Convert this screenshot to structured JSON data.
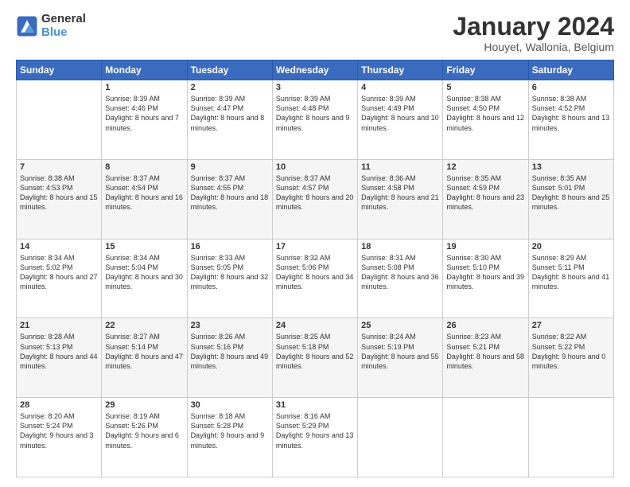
{
  "logo": {
    "line1": "General",
    "line2": "Blue"
  },
  "title": "January 2024",
  "location": "Houyet, Wallonia, Belgium",
  "weekdays": [
    "Sunday",
    "Monday",
    "Tuesday",
    "Wednesday",
    "Thursday",
    "Friday",
    "Saturday"
  ],
  "weeks": [
    [
      {
        "day": "",
        "sunrise": "",
        "sunset": "",
        "daylight": ""
      },
      {
        "day": "1",
        "sunrise": "Sunrise: 8:39 AM",
        "sunset": "Sunset: 4:46 PM",
        "daylight": "Daylight: 8 hours and 7 minutes."
      },
      {
        "day": "2",
        "sunrise": "Sunrise: 8:39 AM",
        "sunset": "Sunset: 4:47 PM",
        "daylight": "Daylight: 8 hours and 8 minutes."
      },
      {
        "day": "3",
        "sunrise": "Sunrise: 8:39 AM",
        "sunset": "Sunset: 4:48 PM",
        "daylight": "Daylight: 8 hours and 9 minutes."
      },
      {
        "day": "4",
        "sunrise": "Sunrise: 8:39 AM",
        "sunset": "Sunset: 4:49 PM",
        "daylight": "Daylight: 8 hours and 10 minutes."
      },
      {
        "day": "5",
        "sunrise": "Sunrise: 8:38 AM",
        "sunset": "Sunset: 4:50 PM",
        "daylight": "Daylight: 8 hours and 12 minutes."
      },
      {
        "day": "6",
        "sunrise": "Sunrise: 8:38 AM",
        "sunset": "Sunset: 4:52 PM",
        "daylight": "Daylight: 8 hours and 13 minutes."
      }
    ],
    [
      {
        "day": "7",
        "sunrise": "Sunrise: 8:38 AM",
        "sunset": "Sunset: 4:53 PM",
        "daylight": "Daylight: 8 hours and 15 minutes."
      },
      {
        "day": "8",
        "sunrise": "Sunrise: 8:37 AM",
        "sunset": "Sunset: 4:54 PM",
        "daylight": "Daylight: 8 hours and 16 minutes."
      },
      {
        "day": "9",
        "sunrise": "Sunrise: 8:37 AM",
        "sunset": "Sunset: 4:55 PM",
        "daylight": "Daylight: 8 hours and 18 minutes."
      },
      {
        "day": "10",
        "sunrise": "Sunrise: 8:37 AM",
        "sunset": "Sunset: 4:57 PM",
        "daylight": "Daylight: 8 hours and 20 minutes."
      },
      {
        "day": "11",
        "sunrise": "Sunrise: 8:36 AM",
        "sunset": "Sunset: 4:58 PM",
        "daylight": "Daylight: 8 hours and 21 minutes."
      },
      {
        "day": "12",
        "sunrise": "Sunrise: 8:35 AM",
        "sunset": "Sunset: 4:59 PM",
        "daylight": "Daylight: 8 hours and 23 minutes."
      },
      {
        "day": "13",
        "sunrise": "Sunrise: 8:35 AM",
        "sunset": "Sunset: 5:01 PM",
        "daylight": "Daylight: 8 hours and 25 minutes."
      }
    ],
    [
      {
        "day": "14",
        "sunrise": "Sunrise: 8:34 AM",
        "sunset": "Sunset: 5:02 PM",
        "daylight": "Daylight: 8 hours and 27 minutes."
      },
      {
        "day": "15",
        "sunrise": "Sunrise: 8:34 AM",
        "sunset": "Sunset: 5:04 PM",
        "daylight": "Daylight: 8 hours and 30 minutes."
      },
      {
        "day": "16",
        "sunrise": "Sunrise: 8:33 AM",
        "sunset": "Sunset: 5:05 PM",
        "daylight": "Daylight: 8 hours and 32 minutes."
      },
      {
        "day": "17",
        "sunrise": "Sunrise: 8:32 AM",
        "sunset": "Sunset: 5:06 PM",
        "daylight": "Daylight: 8 hours and 34 minutes."
      },
      {
        "day": "18",
        "sunrise": "Sunrise: 8:31 AM",
        "sunset": "Sunset: 5:08 PM",
        "daylight": "Daylight: 8 hours and 36 minutes."
      },
      {
        "day": "19",
        "sunrise": "Sunrise: 8:30 AM",
        "sunset": "Sunset: 5:10 PM",
        "daylight": "Daylight: 8 hours and 39 minutes."
      },
      {
        "day": "20",
        "sunrise": "Sunrise: 8:29 AM",
        "sunset": "Sunset: 5:11 PM",
        "daylight": "Daylight: 8 hours and 41 minutes."
      }
    ],
    [
      {
        "day": "21",
        "sunrise": "Sunrise: 8:28 AM",
        "sunset": "Sunset: 5:13 PM",
        "daylight": "Daylight: 8 hours and 44 minutes."
      },
      {
        "day": "22",
        "sunrise": "Sunrise: 8:27 AM",
        "sunset": "Sunset: 5:14 PM",
        "daylight": "Daylight: 8 hours and 47 minutes."
      },
      {
        "day": "23",
        "sunrise": "Sunrise: 8:26 AM",
        "sunset": "Sunset: 5:16 PM",
        "daylight": "Daylight: 8 hours and 49 minutes."
      },
      {
        "day": "24",
        "sunrise": "Sunrise: 8:25 AM",
        "sunset": "Sunset: 5:18 PM",
        "daylight": "Daylight: 8 hours and 52 minutes."
      },
      {
        "day": "25",
        "sunrise": "Sunrise: 8:24 AM",
        "sunset": "Sunset: 5:19 PM",
        "daylight": "Daylight: 8 hours and 55 minutes."
      },
      {
        "day": "26",
        "sunrise": "Sunrise: 8:23 AM",
        "sunset": "Sunset: 5:21 PM",
        "daylight": "Daylight: 8 hours and 58 minutes."
      },
      {
        "day": "27",
        "sunrise": "Sunrise: 8:22 AM",
        "sunset": "Sunset: 5:22 PM",
        "daylight": "Daylight: 9 hours and 0 minutes."
      }
    ],
    [
      {
        "day": "28",
        "sunrise": "Sunrise: 8:20 AM",
        "sunset": "Sunset: 5:24 PM",
        "daylight": "Daylight: 9 hours and 3 minutes."
      },
      {
        "day": "29",
        "sunrise": "Sunrise: 8:19 AM",
        "sunset": "Sunset: 5:26 PM",
        "daylight": "Daylight: 9 hours and 6 minutes."
      },
      {
        "day": "30",
        "sunrise": "Sunrise: 8:18 AM",
        "sunset": "Sunset: 5:28 PM",
        "daylight": "Daylight: 9 hours and 9 minutes."
      },
      {
        "day": "31",
        "sunrise": "Sunrise: 8:16 AM",
        "sunset": "Sunset: 5:29 PM",
        "daylight": "Daylight: 9 hours and 13 minutes."
      },
      {
        "day": "",
        "sunrise": "",
        "sunset": "",
        "daylight": ""
      },
      {
        "day": "",
        "sunrise": "",
        "sunset": "",
        "daylight": ""
      },
      {
        "day": "",
        "sunrise": "",
        "sunset": "",
        "daylight": ""
      }
    ]
  ]
}
